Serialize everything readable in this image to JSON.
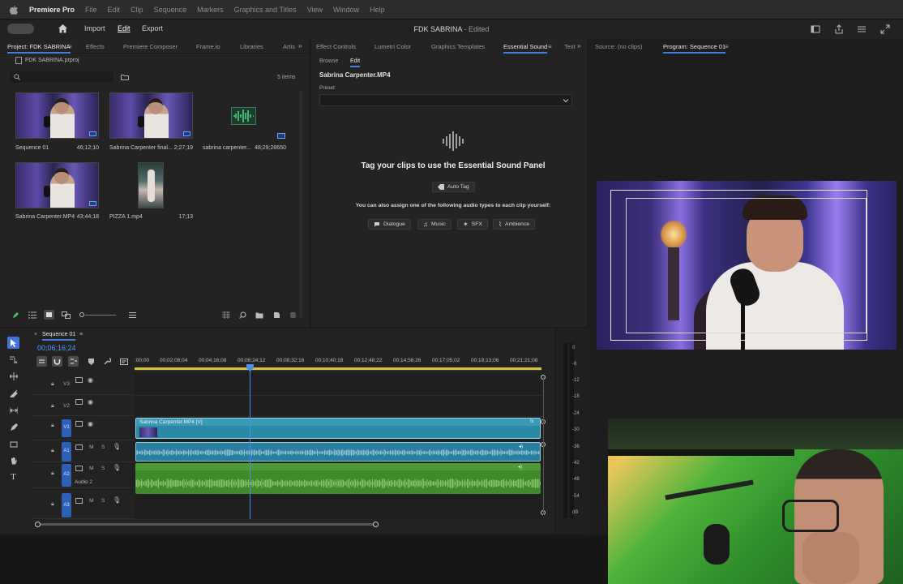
{
  "menubar": {
    "app_name": "Premiere Pro",
    "items": [
      "File",
      "Edit",
      "Clip",
      "Sequence",
      "Markers",
      "Graphics and Titles",
      "View",
      "Window",
      "Help"
    ]
  },
  "header": {
    "import_label": "Import",
    "edit_label": "Edit",
    "export_label": "Export",
    "project_title": "FDK SABRINA",
    "edited_status": "- Edited"
  },
  "project_panel": {
    "tabs": [
      "Project: FDK SABRINA",
      "Effects",
      "Premiere Composer",
      "Frame.io",
      "Libraries",
      "Artis"
    ],
    "file_name": "FDK SABRINA.prproj",
    "item_count": "5 items",
    "items": [
      {
        "name": "Sequence 01",
        "duration": "46;12;10"
      },
      {
        "name": "Sabrina Carpenter final...",
        "duration": "2;27;19"
      },
      {
        "name": "sabrina carpenter...",
        "duration": "48;29;28650"
      },
      {
        "name": "Sabrina Carpenter.MP4",
        "duration": "43;44;18"
      },
      {
        "name": "PIZZA 1.mp4",
        "duration": "17;13"
      }
    ]
  },
  "middle_panel": {
    "tabs": [
      "Effect Controls",
      "Lumetri Color",
      "Graphics Templates",
      "Essential Sound",
      "Text"
    ],
    "sub_tabs": [
      "Browse",
      "Edit"
    ],
    "clip_title": "Sabrina Carpenter.MP4",
    "preset_label": "Preset:",
    "tag_heading": "Tag your clips to use the Essential Sound Panel",
    "auto_tag_label": "Auto Tag",
    "assign_text": "You can also assign one of the following audio types to each clip yourself:",
    "audio_types": [
      "Dialogue",
      "Music",
      "SFX",
      "Ambience"
    ]
  },
  "source_panel": {
    "label": "Source: (no clips)"
  },
  "program_panel": {
    "label": "Program: Sequence 01"
  },
  "timeline": {
    "sequence_name": "Sequence 01",
    "timecode": "00;06;16;24",
    "ruler": [
      ":00;00",
      "00;02;08;04",
      "00;04;16;08",
      "00;06;24;12",
      "00;08;32;16",
      "00;10;40;18",
      "00;12;48;22",
      "00;14;56;26",
      "00;17;05;02",
      "00;19;13;06",
      "00;21;21;08"
    ],
    "tracks": [
      {
        "id": "V3",
        "mute": "",
        "solo": ""
      },
      {
        "id": "V2",
        "mute": "",
        "solo": ""
      },
      {
        "id": "V1",
        "mute": "",
        "solo": ""
      },
      {
        "id": "A1",
        "mute": "M",
        "solo": "S"
      },
      {
        "id": "A2",
        "mute": "M",
        "solo": "S"
      },
      {
        "id": "A3",
        "mute": "M",
        "solo": "S"
      }
    ],
    "audio2_label": "Audio 2",
    "video_clip_label": "Sabrina Carpenter.MP4 [V]"
  },
  "meter": {
    "ticks": [
      "0",
      "-6",
      "-12",
      "-18",
      "-24",
      "-30",
      "-36",
      "-42",
      "-48",
      "-54",
      "dB"
    ]
  },
  "colors": {
    "accent": "#3f7fd8",
    "video_clip": "#2a8aa6",
    "audio_clip_a1": "#2a7fa0",
    "audio_clip_a2": "#3f8a2a",
    "playhead": "#4a8ee8"
  }
}
